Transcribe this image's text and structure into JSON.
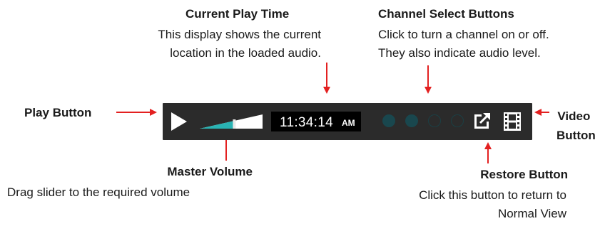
{
  "annotations": {
    "current_play_time": {
      "title": "Current Play Time",
      "desc_line1": "This display shows the current",
      "desc_line2": "location in the loaded audio."
    },
    "channel_select": {
      "title": "Channel Select Buttons",
      "desc_line1": "Click to turn a channel on or off.",
      "desc_line2": "They also indicate audio level."
    },
    "play_button": {
      "title": "Play Button"
    },
    "video_button": {
      "title_line1": "Video",
      "title_line2": "Button"
    },
    "master_volume": {
      "title": "Master Volume",
      "desc": "Drag slider to the required volume"
    },
    "restore_button": {
      "title": "Restore Button",
      "desc_line1": "Click this button to return to",
      "desc_line2": "Normal View"
    }
  },
  "player": {
    "time": "11:34:14",
    "ampm": "AM",
    "volume_level": 0.55,
    "channels": [
      {
        "state": "on"
      },
      {
        "state": "on"
      },
      {
        "state": "off"
      },
      {
        "state": "off"
      }
    ],
    "icons": {
      "play": "play-icon",
      "restore": "external-link-icon",
      "video": "film-strip-icon"
    },
    "colors": {
      "bar_background": "#2b2b2b",
      "time_background": "#000000",
      "volume_fill": "#29b3b3",
      "channel_on": "#19474e",
      "channel_off_ring": "#1b3f44",
      "arrow": "#e32020"
    }
  }
}
